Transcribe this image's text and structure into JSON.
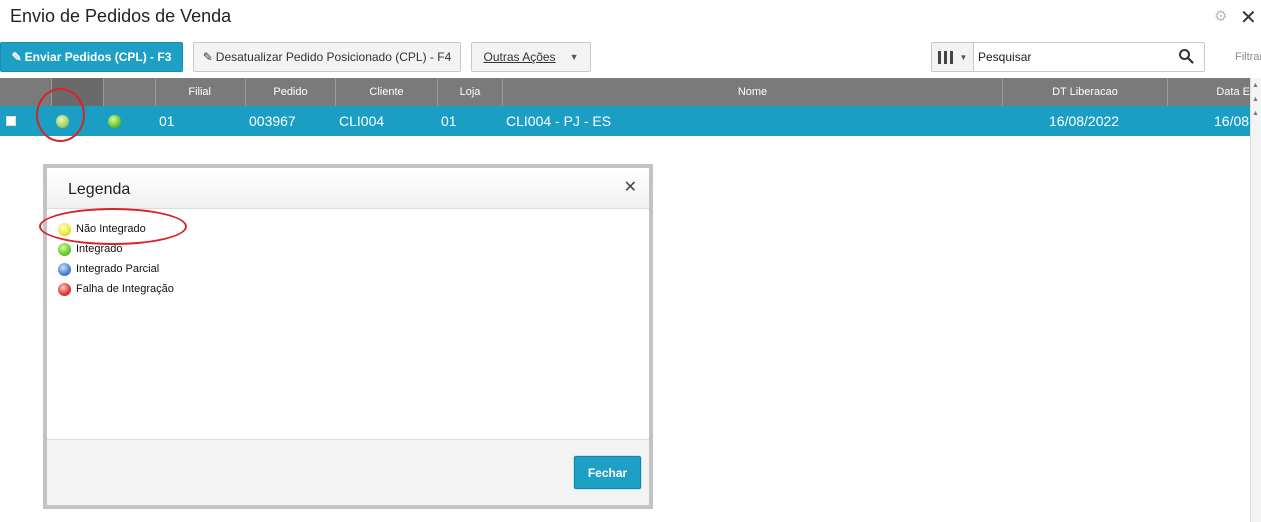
{
  "header": {
    "title": "Envio de Pedidos de Venda",
    "gear_icon": "gear-icon",
    "close_icon": "close-icon"
  },
  "toolbar": {
    "enviar_label": "Enviar Pedidos (CPL) - F3",
    "desatualizar_label": "Desatualizar Pedido Posicionado (CPL) - F4",
    "outras_label": "Outras Ações",
    "search_value": "Pesquisar",
    "filtrar_label": "Filtrar"
  },
  "grid": {
    "columns": [
      "Filial",
      "Pedido",
      "Cliente",
      "Loja",
      "Nome",
      "DT Liberacao",
      "Data E"
    ],
    "row": {
      "filial": "01",
      "pedido": "003967",
      "cliente": "CLI004",
      "loja": "01",
      "nome": "CLI004 - PJ - ES",
      "dt_liberacao": "16/08/2022",
      "data_e": "16/08"
    }
  },
  "legend_dialog": {
    "title": "Legenda",
    "items": [
      {
        "label": "Não Integrado",
        "color": "#ecec3a"
      },
      {
        "label": "Integrado",
        "color": "#6fcf2a"
      },
      {
        "label": "Integrado Parcial",
        "color": "#4f86d1"
      },
      {
        "label": "Falha de Integração",
        "color": "#e33c3c"
      }
    ],
    "close_label": "Fechar"
  },
  "colors": {
    "accent": "#1e9fc4",
    "header_gray": "#7a7a7a",
    "annotation_red": "#d9222a"
  }
}
